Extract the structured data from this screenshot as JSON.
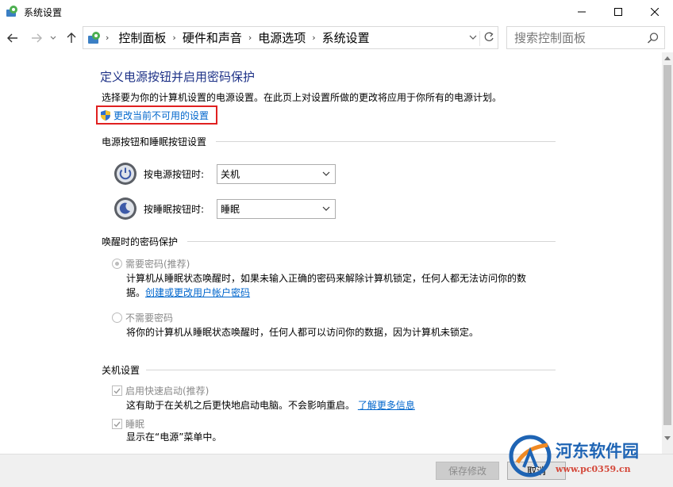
{
  "window": {
    "title": "系统设置",
    "controls": [
      "minimize",
      "maximize",
      "close"
    ]
  },
  "nav": {
    "breadcrumbs": [
      "控制面板",
      "硬件和声音",
      "电源选项",
      "系统设置"
    ],
    "search_placeholder": "搜索控制面板"
  },
  "page": {
    "heading": "定义电源按钮并启用密码保护",
    "description": "选择要为你的计算机设置的电源设置。在此页上对设置所做的更改将应用于你所有的电源计划。",
    "change_link": "更改当前不可用的设置"
  },
  "power_section": {
    "title": "电源按钮和睡眠按钮设置",
    "power_button_label": "按电源按钮时:",
    "power_button_value": "关机",
    "sleep_button_label": "按睡眠按钮时:",
    "sleep_button_value": "睡眠"
  },
  "password_section": {
    "title": "唤醒时的密码保护",
    "require_label": "需要密码(推荐)",
    "require_desc_1": "计算机从睡眠状态唤醒时，如果未输入正确的密码来解除计算机锁定，任何人都无法访问你的数",
    "require_desc_2": "据。",
    "require_link": "创建或更改用户帐户密码",
    "norequire_label": "不需要密码",
    "norequire_desc": "将你的计算机从睡眠状态唤醒时，任何人都可以访问你的数据，因为计算机未锁定。"
  },
  "shutdown_section": {
    "title": "关机设置",
    "fast_startup_label": "启用快速启动(推荐)",
    "fast_startup_desc": "这有助于在关机之后更快地启动电脑。不会影响重启。",
    "fast_startup_link": "了解更多信息",
    "sleep_label": "睡眠",
    "sleep_desc": "显示在“电源”菜单中。"
  },
  "footer": {
    "save_label": "保存修改",
    "cancel_label": "取消"
  },
  "watermark": {
    "title": "河东软件园",
    "url": "www.pc0359.cn"
  },
  "colors": {
    "heading": "#1e3287",
    "link": "#0066cc",
    "highlight_border": "#e02020",
    "watermark_blue": "#1e64b4",
    "watermark_red": "#d4483a"
  }
}
